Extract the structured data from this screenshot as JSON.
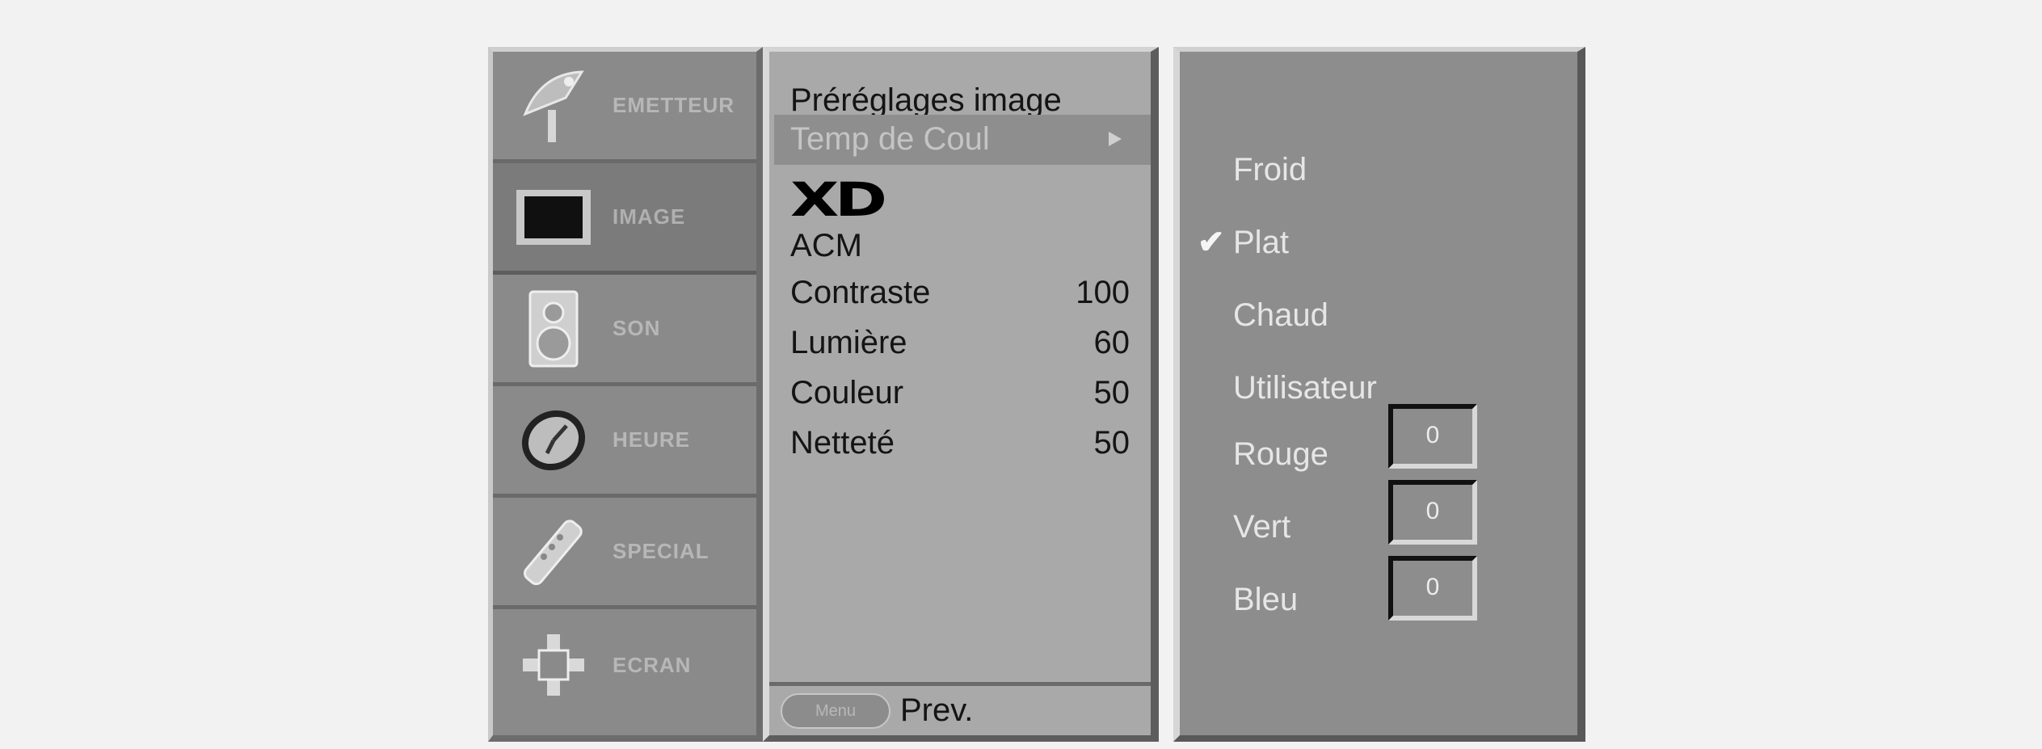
{
  "sidebar": {
    "items": [
      {
        "label": "EMETTEUR",
        "icon": "antenna-icon"
      },
      {
        "label": "IMAGE",
        "icon": "tv-icon",
        "active": true
      },
      {
        "label": "SON",
        "icon": "speaker-icon"
      },
      {
        "label": "HEURE",
        "icon": "clock-icon"
      },
      {
        "label": "SPECIAL",
        "icon": "remote-icon"
      },
      {
        "label": "ECRAN",
        "icon": "screen-adjust-icon"
      }
    ]
  },
  "picture_menu": {
    "rows": [
      {
        "label": "Préréglages image",
        "value": ""
      },
      {
        "label": "Temp de Coul",
        "value": ""
      },
      {
        "label": "XD",
        "value": ""
      },
      {
        "label": "ACM",
        "value": ""
      },
      {
        "label": "Contraste",
        "value": "100"
      },
      {
        "label": "Lumière",
        "value": "60"
      },
      {
        "label": "Couleur",
        "value": "50"
      },
      {
        "label": "Netteté",
        "value": "50"
      }
    ],
    "footer": {
      "menu_button": "Menu",
      "prev_label": "Prev."
    }
  },
  "color_temp_menu": {
    "options": [
      "Froid",
      "Plat",
      "Chaud",
      "Utilisateur"
    ],
    "selected_index": 1,
    "check_mark": "✔",
    "channels": [
      {
        "label": "Rouge",
        "value": "0"
      },
      {
        "label": "Vert",
        "value": "0"
      },
      {
        "label": "Bleu",
        "value": "0"
      }
    ]
  }
}
